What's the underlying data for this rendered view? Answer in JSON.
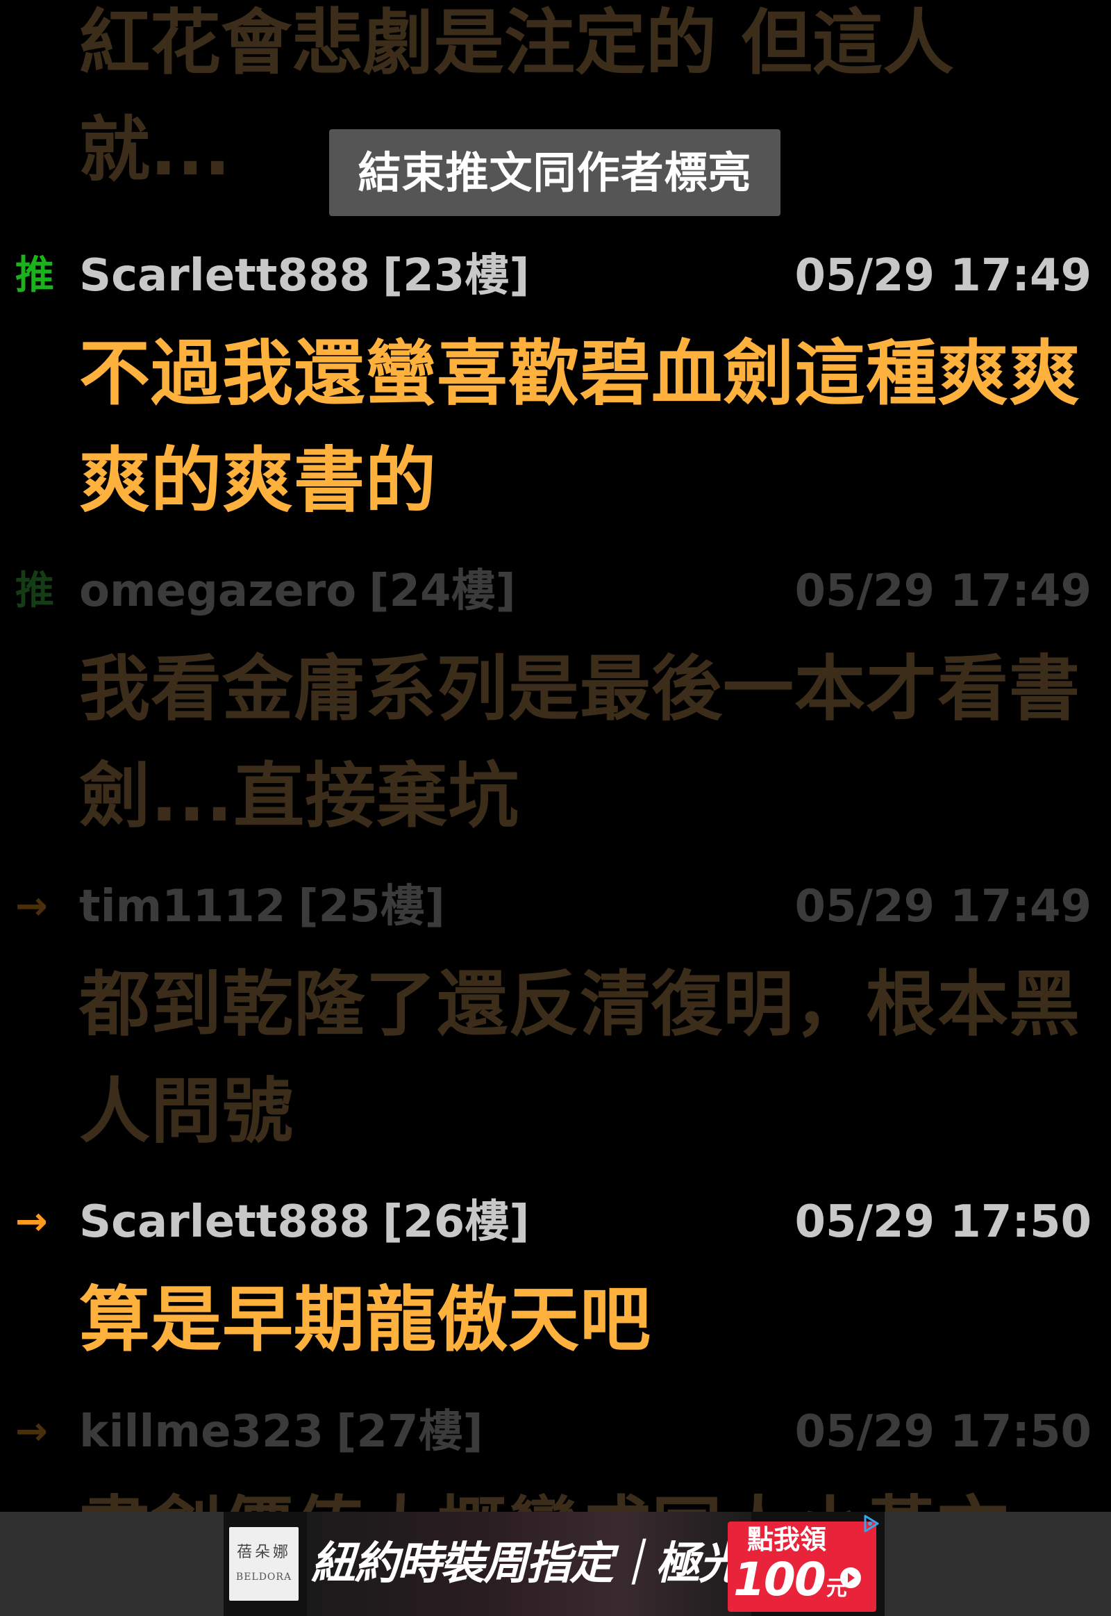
{
  "top_partial": {
    "text": "紅花會悲劇是注定的  但這人就..."
  },
  "banner": {
    "label": "結束推文同作者標亮"
  },
  "comments": [
    {
      "tag": "推",
      "user": "Scarlett888",
      "floor": "[23樓]",
      "time": "05/29 17:49",
      "text": "不過我還蠻喜歡碧血劍這種爽爽爽的爽書的"
    },
    {
      "tag": "推",
      "user": "omegazero",
      "floor": "[24樓]",
      "time": "05/29 17:49",
      "text": "我看金庸系列是最後一本才看書劍...直接棄坑"
    },
    {
      "tag": "→",
      "user": "tim1112",
      "floor": "[25樓]",
      "time": "05/29 17:49",
      "text": "都到乾隆了還反清復明，根本黑人問號"
    },
    {
      "tag": "→",
      "user": "Scarlett888",
      "floor": "[26樓]",
      "time": "05/29 17:50",
      "text": "算是早期龍傲天吧"
    },
    {
      "tag": "→",
      "user": "killme323",
      "floor": "[27樓]",
      "time": "05/29 17:50",
      "text": "書劍價值大概蠻成同人小黃文"
    }
  ],
  "ad": {
    "logo_cn": "蓓朵娜",
    "logo_en": "BELDORA",
    "text": "紐約時裝周指定｜極光CC霜",
    "cta_top": "點我領",
    "cta_amount": "100",
    "cta_unit": "元",
    "choice_icon": "adchoices-icon"
  },
  "colors": {
    "background": "#000000",
    "highlight_text": "#ffb13d",
    "faded_text": "#3b2d1a",
    "push_tag": "#1bb31b",
    "arrow_tag": "#ff9a1f",
    "banner_bg": "#555555",
    "ad_cta": "#e8233a"
  }
}
